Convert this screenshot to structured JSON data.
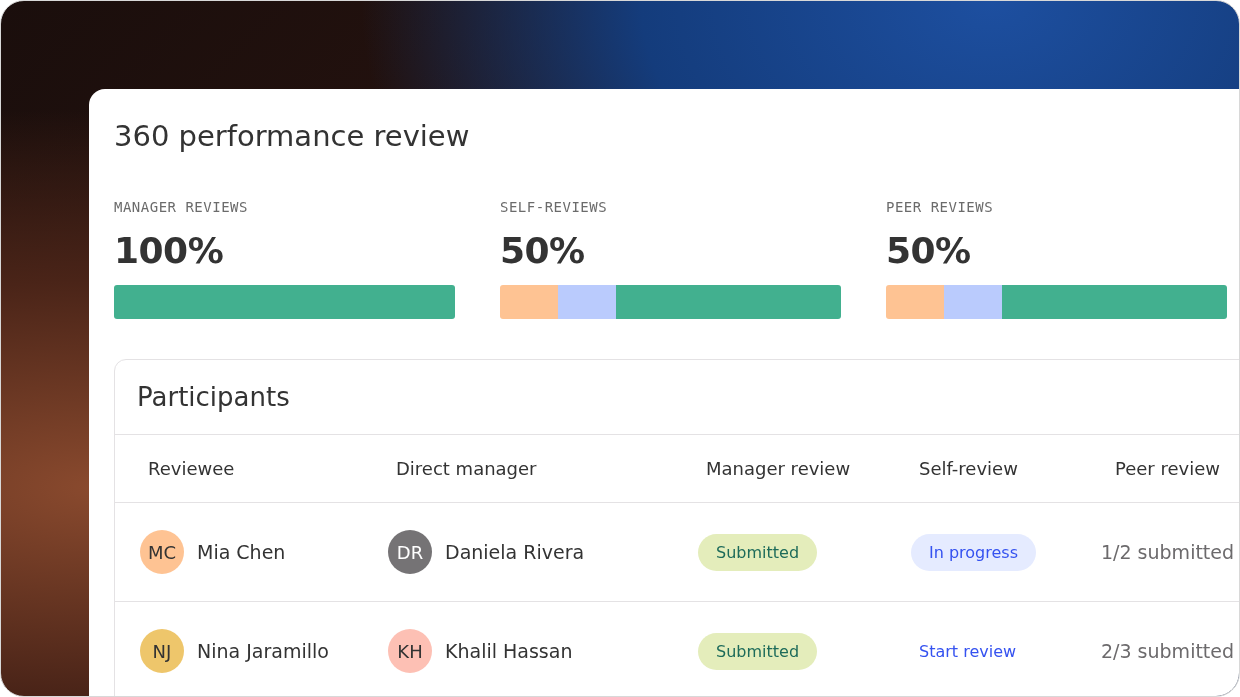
{
  "title": "360 performance review",
  "stats": [
    {
      "label": "MANAGER REVIEWS",
      "value": "100%",
      "segments": [
        {
          "level": 1,
          "color": "#42b08f"
        }
      ]
    },
    {
      "label": "SELF-REVIEWS",
      "value": "50%",
      "segments": [
        {
          "level": 0.17,
          "color": "#fec393"
        },
        {
          "level": 0.17,
          "color": "#bacbfd"
        },
        {
          "level": 0.66,
          "color": "#42b08f"
        }
      ]
    },
    {
      "label": "PEER REVIEWS",
      "value": "50%",
      "segments": [
        {
          "level": 0.17,
          "color": "#fec393"
        },
        {
          "level": 0.17,
          "color": "#bacbfd"
        },
        {
          "level": 0.66,
          "color": "#42b08f"
        }
      ]
    }
  ],
  "participants": {
    "title": "Participants",
    "columns": [
      "Reviewee",
      "Direct manager",
      "Manager review",
      "Self-review",
      "Peer review"
    ],
    "rows": [
      {
        "reviewee": {
          "initials": "MC",
          "name": "Mia Chen",
          "color": "#fec393"
        },
        "manager": {
          "initials": "DR",
          "name": "Daniela Rivera",
          "color": "#757375"
        },
        "manager_review": {
          "kind": "submitted",
          "text": "Submitted"
        },
        "self_review": {
          "kind": "progress",
          "text": "In progress"
        },
        "peer_review": "1/2 submitted"
      },
      {
        "reviewee": {
          "initials": "NJ",
          "name": "Nina Jaramillo",
          "color": "#eec66b"
        },
        "manager": {
          "initials": "KH",
          "name": "Khalil Hassan",
          "color": "#fdc0b4"
        },
        "manager_review": {
          "kind": "submitted",
          "text": "Submitted"
        },
        "self_review": {
          "kind": "link",
          "text": "Start review"
        },
        "peer_review": "2/3 submitted"
      }
    ]
  }
}
